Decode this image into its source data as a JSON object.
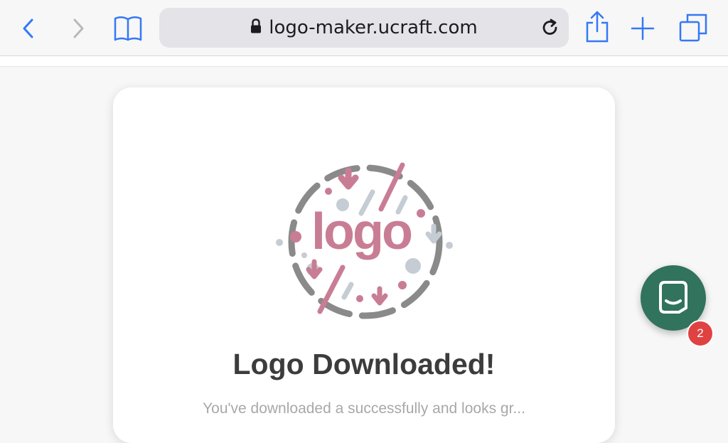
{
  "browser": {
    "url": "logo-maker.ucraft.com",
    "icons": {
      "back": "chevron-left-icon",
      "forward": "chevron-right-icon",
      "bookmarks": "book-icon",
      "lock": "lock-icon",
      "reload": "reload-icon",
      "share": "share-icon",
      "new_tab": "plus-icon",
      "tabs": "tabs-icon"
    },
    "accent_color": "#3478f6"
  },
  "card": {
    "illustration": "logo-illustration",
    "illustration_word": "logo",
    "title": "Logo Downloaded!",
    "subtitle": "You've downloaded a successfully and looks gr..."
  },
  "chat_widget": {
    "icon": "chat-icon",
    "badge_count": "2",
    "color": "#31735d"
  }
}
